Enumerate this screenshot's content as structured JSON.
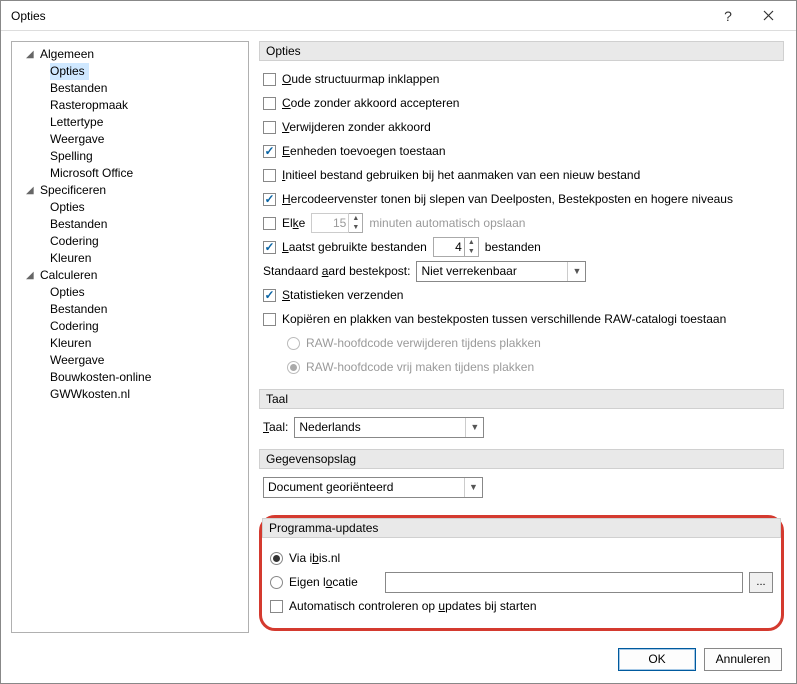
{
  "window": {
    "title": "Opties",
    "help": "?",
    "close": "×"
  },
  "tree": {
    "groups": [
      {
        "label": "Algemeen",
        "items": [
          "Opties",
          "Bestanden",
          "Rasteropmaak",
          "Lettertype",
          "Weergave",
          "Spelling",
          "Microsoft Office"
        ],
        "selected": 0
      },
      {
        "label": "Specificeren",
        "items": [
          "Opties",
          "Bestanden",
          "Codering",
          "Kleuren"
        ]
      },
      {
        "label": "Calculeren",
        "items": [
          "Opties",
          "Bestanden",
          "Codering",
          "Kleuren",
          "Weergave",
          "Bouwkosten-online",
          "GWWkosten.nl"
        ]
      }
    ]
  },
  "sections": {
    "opties": {
      "title": "Opties",
      "cb_oude": {
        "pre": "O",
        "text": "ude structuurmap inklappen",
        "checked": false
      },
      "cb_code": {
        "pre": "C",
        "text": "ode zonder akkoord accepteren",
        "checked": false
      },
      "cb_verw": {
        "pre": "V",
        "text": "erwijderen zonder akkoord",
        "checked": false
      },
      "cb_eenh": {
        "pre": "E",
        "text": "enheden toevoegen toestaan",
        "checked": true
      },
      "cb_init": {
        "pre": "I",
        "text": "nitieel bestand gebruiken bij het aanmaken van een nieuw bestand",
        "checked": false
      },
      "cb_herc": {
        "pre": "H",
        "text": "ercodeervenster tonen bij slepen van Deelposten, Bestekposten en hogere niveaus",
        "checked": true
      },
      "cb_elke": {
        "pre": "El",
        "u": "k",
        "post": "e",
        "checked": false,
        "value": "15",
        "suffix": "minuten automatisch opslaan"
      },
      "cb_laatst": {
        "pre": "L",
        "text": "aatst gebruikte bestanden",
        "checked": true,
        "value": "4",
        "suffix": "bestanden"
      },
      "aard": {
        "label_pre": "Standaard ",
        "label_u": "a",
        "label_post": "ard bestekpost:",
        "value": "Niet verrekenbaar"
      },
      "cb_stat": {
        "pre": "S",
        "text": "tatistieken verzenden",
        "checked": true
      },
      "cb_kop": {
        "text": "Kopiëren en plakken van bestekposten tussen verschillende RAW-catalogi toestaan",
        "checked": false
      },
      "rb_raw1": {
        "text": "RAW-hoofdcode verwijderen tijdens plakken"
      },
      "rb_raw2": {
        "text": "RAW-hoofdcode vrij maken tijdens plakken"
      }
    },
    "taal": {
      "title": "Taal",
      "label_pre": "",
      "label_u": "T",
      "label_post": "aal:",
      "value": "Nederlands"
    },
    "gegevens": {
      "title": "Gegevensopslag",
      "value": "Document georiënteerd"
    },
    "updates": {
      "title": "Programma-updates",
      "rb_via": {
        "text_pre": "Via i",
        "text_u": "b",
        "text_post": "is.nl",
        "checked": true
      },
      "rb_eigen": {
        "text_pre": "Eigen l",
        "text_u": "o",
        "text_post": "catie",
        "checked": false
      },
      "browse": "...",
      "cb_auto": {
        "text_pre": "Automatisch controleren op ",
        "text_u": "u",
        "text_post": "pdates bij starten",
        "checked": false
      }
    }
  },
  "footer": {
    "ok": "OK",
    "cancel": "Annuleren"
  }
}
